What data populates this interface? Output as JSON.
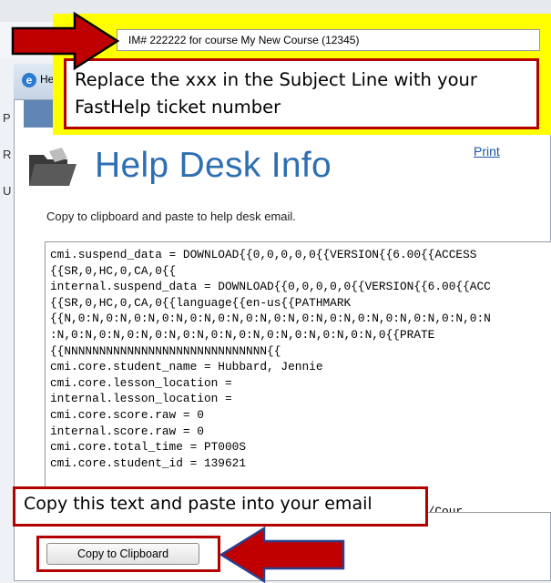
{
  "email": {
    "subject_value": "IM# 222222 for course My New Course (12345)",
    "side_letters": [
      "P",
      "R",
      "U"
    ]
  },
  "help_window": {
    "title": "He",
    "heading": "Help Desk Info",
    "print_label": "Print",
    "instruction": "Copy to clipboard and paste to help desk email.",
    "data_text": "cmi.suspend_data = DOWNLOAD{{0,0,0,0,0{{VERSION{{6.00{{ACCESS\n{{SR,0,HC,0,CA,0{{\ninternal.suspend_data = DOWNLOAD{{0,0,0,0,0{{VERSION{{6.00{{ACC\n{{SR,0,HC,0,CA,0{{language{{en-us{{PATHMARK\n{{N,0:N,0:N,0:N,0:N,0:N,0:N,0:N,0:N,0:N,0:N,0:N,0:N,0:N,0:N,0:N\n:N,0:N,0:N,0:N,0:N,0:N,0:N,0:N,0:N,0:N,0:N,0:N,0{{PRATE\n{{NNNNNNNNNNNNNNNNNNNNNNNNNNNNN{{\ncmi.core.student_name = Hubbard, Jennie\ncmi.core.lesson_location =\ninternal.lesson_location =\ncmi.core.score.raw = 0\ninternal.score.raw = 0\ncmi.core.total_time = PT000S\ncmi.core.student_id = 139621\n\n\n                                           2_0403/SCO1/Cour",
    "copy_button_label": "Copy to Clipboard"
  },
  "annotations": {
    "top_callout": "Replace the xxx in the Subject Line with your FastHelp ticket number",
    "bottom_callout": "Copy this text and paste into your email"
  },
  "colors": {
    "highlight_yellow": "#ffff00",
    "annotation_red": "#b30000",
    "heading_blue": "#2e6fb2"
  }
}
